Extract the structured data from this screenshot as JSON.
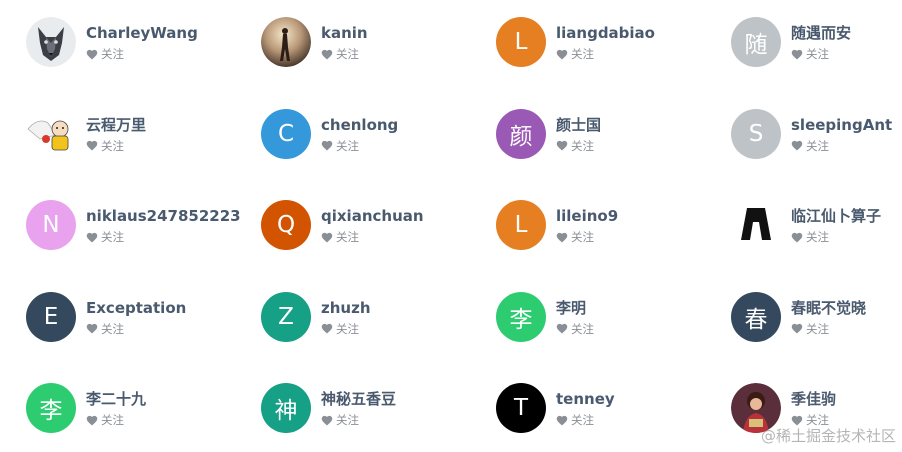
{
  "users": [
    {
      "name": "CharleyWang",
      "follow": "关注",
      "avatar": {
        "type": "image",
        "icon": "wolf-avatar-image"
      }
    },
    {
      "name": "kanin",
      "follow": "关注",
      "avatar": {
        "type": "image",
        "icon": "silhouette-photo-avatar-image"
      }
    },
    {
      "name": "liangdabiao",
      "follow": "关注",
      "avatar": {
        "type": "letter",
        "letter": "L",
        "color": "#E67E22"
      }
    },
    {
      "name": "随遇而安",
      "follow": "关注",
      "avatar": {
        "type": "letter",
        "letter": "随",
        "color": "#BDC3C7"
      }
    },
    {
      "name": "云程万里",
      "follow": "关注",
      "avatar": {
        "type": "image",
        "icon": "saitama-cartoon-avatar-image"
      }
    },
    {
      "name": "chenlong",
      "follow": "关注",
      "avatar": {
        "type": "letter",
        "letter": "C",
        "color": "#3498DB"
      }
    },
    {
      "name": "颜士国",
      "follow": "关注",
      "avatar": {
        "type": "letter",
        "letter": "颜",
        "color": "#9B59B6"
      }
    },
    {
      "name": "sleepingAnt",
      "follow": "关注",
      "avatar": {
        "type": "letter",
        "letter": "S",
        "color": "#BDC3C7"
      }
    },
    {
      "name": "niklaus247852223",
      "follow": "关注",
      "avatar": {
        "type": "letter",
        "letter": "N",
        "color": "#E8A2EE"
      }
    },
    {
      "name": "qixianchuan",
      "follow": "关注",
      "avatar": {
        "type": "letter",
        "letter": "Q",
        "color": "#D35400"
      }
    },
    {
      "name": "lileino9",
      "follow": "关注",
      "avatar": {
        "type": "letter",
        "letter": "L",
        "color": "#E67E22"
      }
    },
    {
      "name": "临江仙卜算子",
      "follow": "关注",
      "avatar": {
        "type": "image",
        "icon": "black-logo-avatar-image"
      }
    },
    {
      "name": "Exceptation",
      "follow": "关注",
      "avatar": {
        "type": "letter",
        "letter": "E",
        "color": "#34495E"
      }
    },
    {
      "name": "zhuzh",
      "follow": "关注",
      "avatar": {
        "type": "letter",
        "letter": "Z",
        "color": "#16A085"
      }
    },
    {
      "name": "李明",
      "follow": "关注",
      "avatar": {
        "type": "letter",
        "letter": "李",
        "color": "#2ECC71"
      }
    },
    {
      "name": "春眠不觉晓",
      "follow": "关注",
      "avatar": {
        "type": "letter",
        "letter": "春",
        "color": "#34495E"
      }
    },
    {
      "name": "李二十九",
      "follow": "关注",
      "avatar": {
        "type": "letter",
        "letter": "李",
        "color": "#2ECC71"
      }
    },
    {
      "name": "神秘五香豆",
      "follow": "关注",
      "avatar": {
        "type": "letter",
        "letter": "神",
        "color": "#16A085"
      }
    },
    {
      "name": "tenney",
      "follow": "关注",
      "avatar": {
        "type": "letter",
        "letter": "T",
        "color": "#000000"
      }
    },
    {
      "name": "季佳驹",
      "follow": "关注",
      "avatar": {
        "type": "image",
        "icon": "child-photo-avatar-image"
      }
    }
  ],
  "watermark": "@稀土掘金技术社区",
  "colors": {
    "username": "#4a5a6e",
    "follow_text": "#8a8f96",
    "heart": "#8a8f96"
  }
}
